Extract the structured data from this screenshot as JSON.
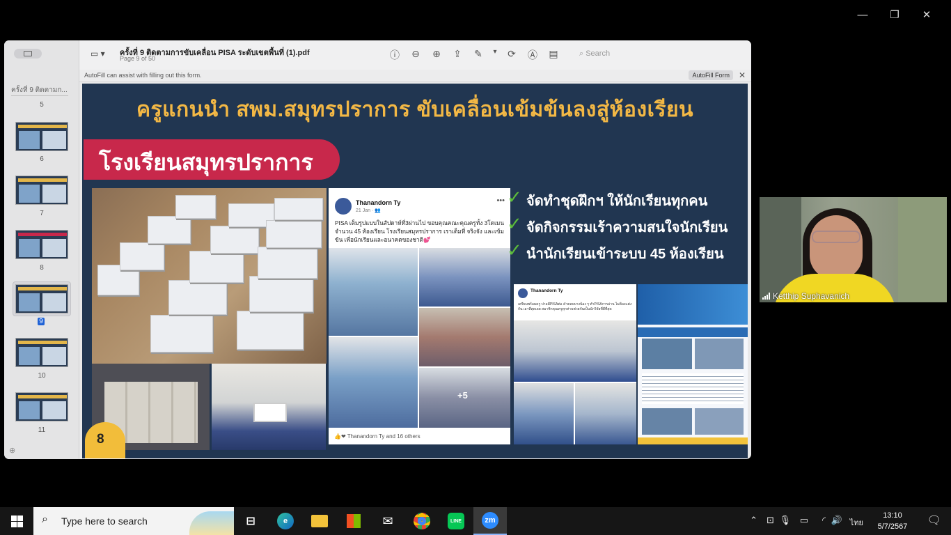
{
  "window_controls": {
    "minimize": "—",
    "restore": "❐",
    "close": "✕"
  },
  "pdf": {
    "title": "ครั้งที่ 9 ติดตามการขับเคลื่อน PISA ระดับเขตพื้นที่  (1).pdf",
    "subtitle": "Page 9 of 50",
    "search_placeholder": "Search",
    "autofill_message": "AutoFill can assist with filling out this form.",
    "autofill_button": "AutoFill Form",
    "sidebar_title": "ครั้งที่ 9 ติดตามก...",
    "thumbnails": [
      "5",
      "6",
      "7",
      "8",
      "9",
      "10",
      "11"
    ],
    "selected_page": "9"
  },
  "slide": {
    "title": "ครูแกนนำ สพม.สมุทรปราการ ขับเคลื่อนเข้มข้นลงสู่ห้องเรียน",
    "ribbon": "โรงเรียนสมุทรปราการ",
    "badge": "8",
    "checks": [
      "จัดทำชุดฝึกฯ ให้นักเรียนทุกคน",
      "จัดกิจกรรมเร้าความสนใจนักเรียน",
      "นำนักเรียนเข้าระบบ 45 ห้องเรียน"
    ],
    "post1": {
      "name": "Thanandorn Ty",
      "time": "21 Jan · ",
      "text": "PISA เต็มรูปแบบในสัปดาห์ที่3ผ่านไป ขอบคุณคณะคุณครูทั้ง 3โดเมน จำนวน 45 ห้องเรียน โรงเรียนสมุทรปราการ เราเต็มที่ จริงจัง และเข้มข้น เพื่อนักเรียนและอนาคตของชาติ💕",
      "more_photos": "+5",
      "reactions": "Thanandorn Ty and 16 others"
    },
    "post2": {
      "name": "Thanandorn Ty",
      "text": "เตรียมพร้อมครู ปาลมีPISAต่อ คำตอบบางน้อง ๆ ทำPISAการอ่าน ไม่ต้องแต่งกัน เอาที่สุดเลย สมาชิกคุณครูทุกท่านช่วยกันเป็นนักวิจัยที่ดีที่สุด"
    }
  },
  "video": {
    "participant": "Ketthip Suphavanich"
  },
  "taskbar": {
    "search_placeholder": "Type here to search",
    "apps": [
      "task-view",
      "edge",
      "file-explorer",
      "store",
      "mail",
      "chrome",
      "line",
      "zoom"
    ],
    "zoom_label": "zm",
    "line_label": "LINE",
    "lang": "ไทย",
    "time": "13:10",
    "date": "5/7/2567"
  }
}
